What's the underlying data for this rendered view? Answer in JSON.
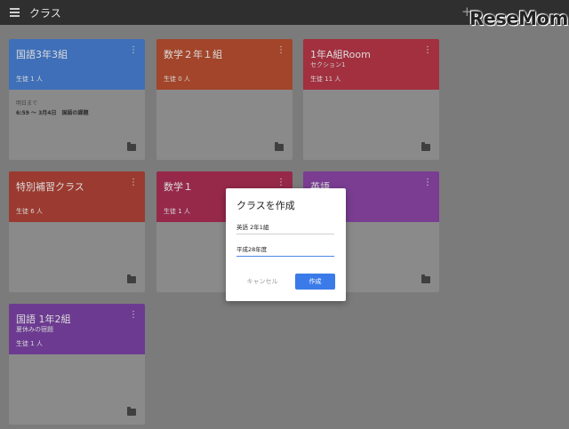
{
  "app_bar": {
    "title": "クラス",
    "menu_icon": "hamburger-menu-icon",
    "add_icon": "+"
  },
  "watermark": "ReseMom",
  "cards": [
    {
      "name": "国語3年3組",
      "subtitle": "",
      "count": "生徒 1 人",
      "color": "#3f6fb8",
      "due_label": "明日まで",
      "due_detail": "6:59 ～ 3月4日　国語の課題"
    },
    {
      "name": "数学２年１組",
      "subtitle": "",
      "count": "生徒 0 人",
      "color": "#a2452a"
    },
    {
      "name": "1年A組Room",
      "subtitle": "セクション1",
      "count": "生徒 11 人",
      "color": "#a2303f"
    },
    {
      "name": "特別補習クラス",
      "subtitle": "",
      "count": "生徒 6 人",
      "color": "#9b3a30"
    },
    {
      "name": "数学１",
      "subtitle": "",
      "count": "生徒 1 人",
      "color": "#96294a"
    },
    {
      "name": "英語",
      "subtitle": "",
      "count": "",
      "color": "#7a3d92"
    },
    {
      "name": "国語 1年2組",
      "subtitle": "夏休みの宿題",
      "count": "生徒 1 人",
      "color": "#6c3b91"
    }
  ],
  "dialog": {
    "title": "クラスを作成",
    "class_name_value": "英語 2年1組",
    "section_value": "平成28年度",
    "cancel_label": "キャンセル",
    "create_label": "作成",
    "accent": "#3b7be9"
  }
}
